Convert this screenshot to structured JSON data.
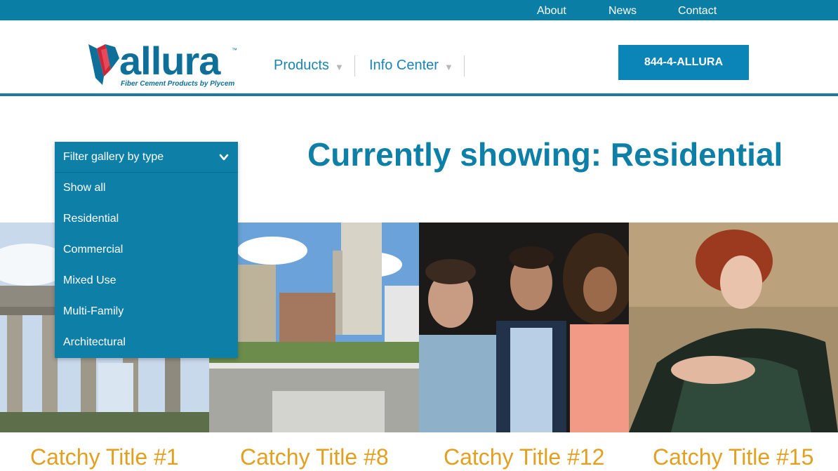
{
  "topnav": {
    "about": "About",
    "news": "News",
    "contact": "Contact"
  },
  "logo": {
    "word": "allura",
    "tm": "™",
    "tagline": "Fiber Cement Products by Plycem"
  },
  "mainnav": {
    "products": "Products",
    "info_center": "Info Center",
    "caret": "▼"
  },
  "phone_button": "844-4-ALLURA",
  "heading": "Currently showing: Residential",
  "filter": {
    "label": "Filter gallery by type",
    "options": [
      "Show all",
      "Residential",
      "Commercial",
      "Mixed Use",
      "Multi-Family",
      "Architectural"
    ]
  },
  "gallery": {
    "tiles": [
      {
        "title": "Catchy Title #1",
        "image": "brandenburg-gate-photo"
      },
      {
        "title": "Catchy Title #8",
        "image": "city-skyline-photo"
      },
      {
        "title": "Catchy Title #12",
        "image": "three-people-portrait-photo"
      },
      {
        "title": "Catchy Title #15",
        "image": "woman-red-hair-portrait-photo"
      }
    ]
  },
  "colors": {
    "topbar": "#0a7ea4",
    "brand_blue": "#0e7fa7",
    "title_orange": "#e2a021"
  }
}
